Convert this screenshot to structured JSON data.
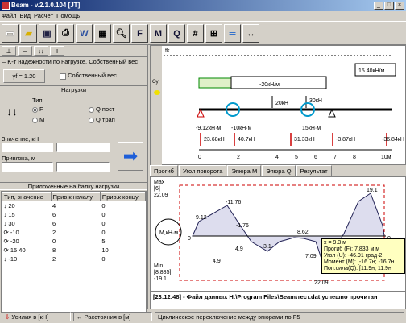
{
  "window": {
    "title": "Beam - v.2.1.0.104 [JT]"
  },
  "menu": [
    "Файл",
    "Вид",
    "Расчёт",
    "Помощь"
  ],
  "left": {
    "tab_label": "K-т надежности по нагрузке, Собственный вес",
    "gamma_button": "γf = 1.20",
    "own_weight_label": "Собственный вес",
    "loads_header": "Нагрузки",
    "type_label": "Тип",
    "types": [
      "F",
      "M",
      "Q пост",
      "Q трап"
    ],
    "value_label": "Значение, кН",
    "bind_label": "Привязка, м",
    "applied_header": "Приложенные на балку нагрузки",
    "cols": [
      "Тип, значение",
      "Прив.к началу",
      "Прив.к концу"
    ],
    "rows": [
      {
        "type": "↓ 20",
        "start": "4",
        "end": "0"
      },
      {
        "type": "↓ 15",
        "start": "6",
        "end": "0"
      },
      {
        "type": "↓ 30",
        "start": "6",
        "end": "0"
      },
      {
        "type": "⟳ -10",
        "start": "2",
        "end": "0"
      },
      {
        "type": "⟳ -20",
        "start": "0",
        "end": "5"
      },
      {
        "type": "⟳ 15  40",
        "start": "8",
        "end": "10"
      },
      {
        "type": "↓ -10",
        "start": "2",
        "end": "0"
      }
    ]
  },
  "scheme": {
    "label_fk": "fk",
    "label_oy": "Oy",
    "load_left": "-20кН/м",
    "load_mid": "-20кН/м",
    "load_right": "15.40кН/м",
    "f1": "20кН",
    "f2": "30кН",
    "m1": "-9.12кН·м",
    "m2": "-10кН·м",
    "m3": "15кН·м",
    "r1": "23.68кН",
    "r2": "40.7кН",
    "r3": "31.33кН",
    "r4": "-3.87кН",
    "r5": "-36.84кН",
    "axis": [
      "0",
      "2",
      "4",
      "5",
      "6",
      "7",
      "8",
      "10м"
    ]
  },
  "tabs": [
    "Прогиб",
    "Угол поворота",
    "Эпюра M",
    "Эпюра Q",
    "Результат"
  ],
  "active_tab": "Эпюра M",
  "plot": {
    "max_label": "Max",
    "max_idx": "[6]",
    "max_val": "22.09",
    "min_label": "Min",
    "min_idx": "[8.885]",
    "min_val": "-19.1",
    "unit": "M,кН·м",
    "values": [
      "9.12",
      "-11.76",
      "-1.76",
      "4.9",
      "3.1",
      "8.62",
      "7.09",
      "22.09",
      "19.1",
      "4.9",
      "0",
      "0"
    ],
    "tooltip": [
      "x = 9.3 м",
      "Прогиб (F): 7.833 м м",
      "Угол (U): -46.91 град·2",
      "Момент (M): [-16.7н; -16.7н",
      "Поп.сила(Q): [11.9н; 11.9н"
    ]
  },
  "message": "[23:12:48] - Файл данных H:\\Program Files\\Beam\\тест.dat успешно прочитан",
  "status": [
    "Усилия в [кН]",
    "Расстояния в [м]",
    "Циклическое переключение между эпюрами по F5"
  ]
}
